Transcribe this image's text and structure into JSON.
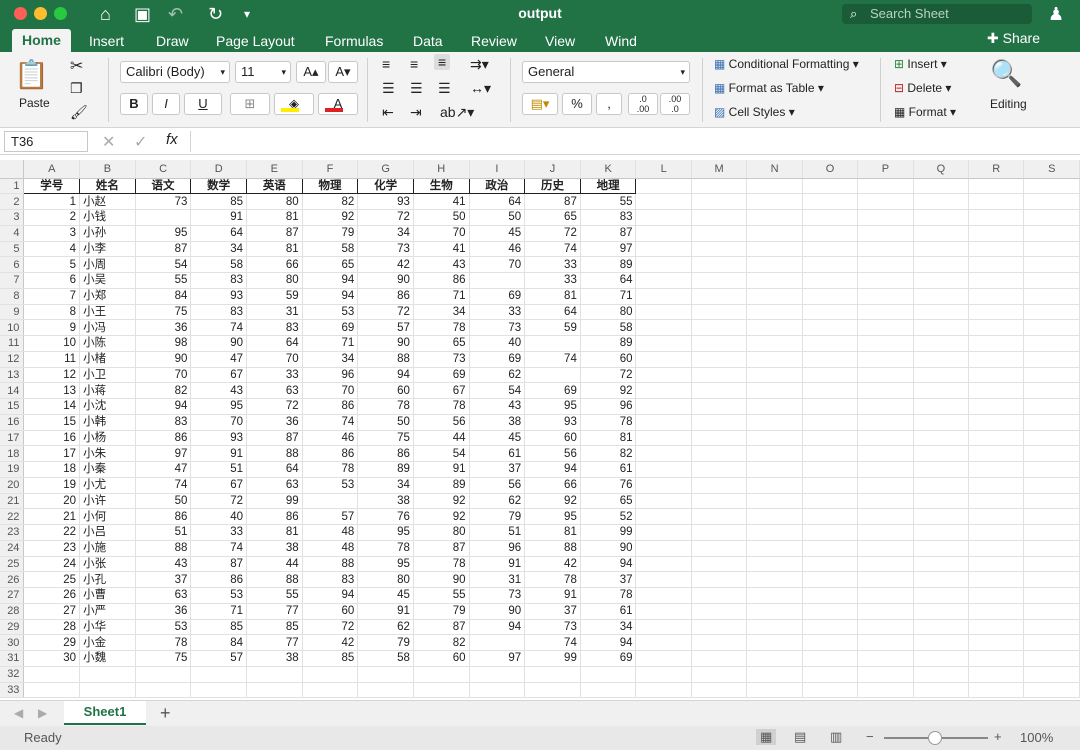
{
  "window": {
    "title": "output",
    "search_placeholder": "Search Sheet"
  },
  "tabs": [
    "Home",
    "Insert",
    "Draw",
    "Page Layout",
    "Formulas",
    "Data",
    "Review",
    "View",
    "Wind"
  ],
  "share_label": "Share",
  "ribbon": {
    "paste": "Paste",
    "font_name": "Calibri (Body)",
    "font_size": "11",
    "number_format": "General",
    "conditional_formatting": "Conditional Formatting",
    "format_as_table": "Format as Table",
    "cell_styles": "Cell Styles",
    "insert": "Insert",
    "delete": "Delete",
    "format": "Format",
    "editing": "Editing"
  },
  "formula_bar": {
    "name_box": "T36",
    "fx": "fx",
    "value": ""
  },
  "columns": [
    "A",
    "B",
    "C",
    "D",
    "E",
    "F",
    "G",
    "H",
    "I",
    "J",
    "K",
    "L",
    "M",
    "N",
    "O",
    "P",
    "Q",
    "R",
    "S"
  ],
  "headers": [
    "学号",
    "姓名",
    "语文",
    "数学",
    "英语",
    "物理",
    "化学",
    "生物",
    "政治",
    "历史",
    "地理"
  ],
  "rows": [
    [
      "1",
      "小赵",
      "73",
      "85",
      "80",
      "82",
      "93",
      "41",
      "64",
      "87",
      "55"
    ],
    [
      "2",
      "小钱",
      "",
      "91",
      "81",
      "92",
      "72",
      "50",
      "50",
      "65",
      "83"
    ],
    [
      "3",
      "小孙",
      "95",
      "64",
      "87",
      "79",
      "34",
      "70",
      "45",
      "72",
      "87"
    ],
    [
      "4",
      "小李",
      "87",
      "34",
      "81",
      "58",
      "73",
      "41",
      "46",
      "74",
      "97"
    ],
    [
      "5",
      "小周",
      "54",
      "58",
      "66",
      "65",
      "42",
      "43",
      "70",
      "33",
      "89"
    ],
    [
      "6",
      "小吴",
      "55",
      "83",
      "80",
      "94",
      "90",
      "86",
      "",
      "33",
      "64"
    ],
    [
      "7",
      "小郑",
      "84",
      "93",
      "59",
      "94",
      "86",
      "71",
      "69",
      "81",
      "71"
    ],
    [
      "8",
      "小王",
      "75",
      "83",
      "31",
      "53",
      "72",
      "34",
      "33",
      "64",
      "80"
    ],
    [
      "9",
      "小冯",
      "36",
      "74",
      "83",
      "69",
      "57",
      "78",
      "73",
      "59",
      "58"
    ],
    [
      "10",
      "小陈",
      "98",
      "90",
      "64",
      "71",
      "90",
      "65",
      "40",
      "",
      "89"
    ],
    [
      "11",
      "小楮",
      "90",
      "47",
      "70",
      "34",
      "88",
      "73",
      "69",
      "74",
      "60"
    ],
    [
      "12",
      "小卫",
      "70",
      "67",
      "33",
      "96",
      "94",
      "69",
      "62",
      "",
      "72"
    ],
    [
      "13",
      "小蒋",
      "82",
      "43",
      "63",
      "70",
      "60",
      "67",
      "54",
      "69",
      "92"
    ],
    [
      "14",
      "小沈",
      "94",
      "95",
      "72",
      "86",
      "78",
      "78",
      "43",
      "95",
      "96"
    ],
    [
      "15",
      "小韩",
      "83",
      "70",
      "36",
      "74",
      "50",
      "56",
      "38",
      "93",
      "78"
    ],
    [
      "16",
      "小杨",
      "86",
      "93",
      "87",
      "46",
      "75",
      "44",
      "45",
      "60",
      "81"
    ],
    [
      "17",
      "小朱",
      "97",
      "91",
      "88",
      "86",
      "86",
      "54",
      "61",
      "56",
      "82"
    ],
    [
      "18",
      "小秦",
      "47",
      "51",
      "64",
      "78",
      "89",
      "91",
      "37",
      "94",
      "61"
    ],
    [
      "19",
      "小尤",
      "74",
      "67",
      "63",
      "53",
      "34",
      "89",
      "56",
      "66",
      "76"
    ],
    [
      "20",
      "小许",
      "50",
      "72",
      "99",
      "",
      "38",
      "92",
      "62",
      "92",
      "65"
    ],
    [
      "21",
      "小何",
      "86",
      "40",
      "86",
      "57",
      "76",
      "92",
      "79",
      "95",
      "52"
    ],
    [
      "22",
      "小吕",
      "51",
      "33",
      "81",
      "48",
      "95",
      "80",
      "51",
      "81",
      "99"
    ],
    [
      "23",
      "小施",
      "88",
      "74",
      "38",
      "48",
      "78",
      "87",
      "96",
      "88",
      "90"
    ],
    [
      "24",
      "小张",
      "43",
      "87",
      "44",
      "88",
      "95",
      "78",
      "91",
      "42",
      "94"
    ],
    [
      "25",
      "小孔",
      "37",
      "86",
      "88",
      "83",
      "80",
      "90",
      "31",
      "78",
      "37"
    ],
    [
      "26",
      "小曹",
      "63",
      "53",
      "55",
      "94",
      "45",
      "55",
      "73",
      "91",
      "78"
    ],
    [
      "27",
      "小严",
      "36",
      "71",
      "77",
      "60",
      "91",
      "79",
      "90",
      "37",
      "61"
    ],
    [
      "28",
      "小华",
      "53",
      "85",
      "85",
      "72",
      "62",
      "87",
      "94",
      "73",
      "34"
    ],
    [
      "29",
      "小金",
      "78",
      "84",
      "77",
      "42",
      "79",
      "82",
      "",
      "74",
      "94"
    ],
    [
      "30",
      "小魏",
      "75",
      "57",
      "38",
      "85",
      "58",
      "60",
      "97",
      "99",
      "69"
    ]
  ],
  "sheet_tab": "Sheet1",
  "status": {
    "ready": "Ready",
    "zoom": "100%"
  }
}
